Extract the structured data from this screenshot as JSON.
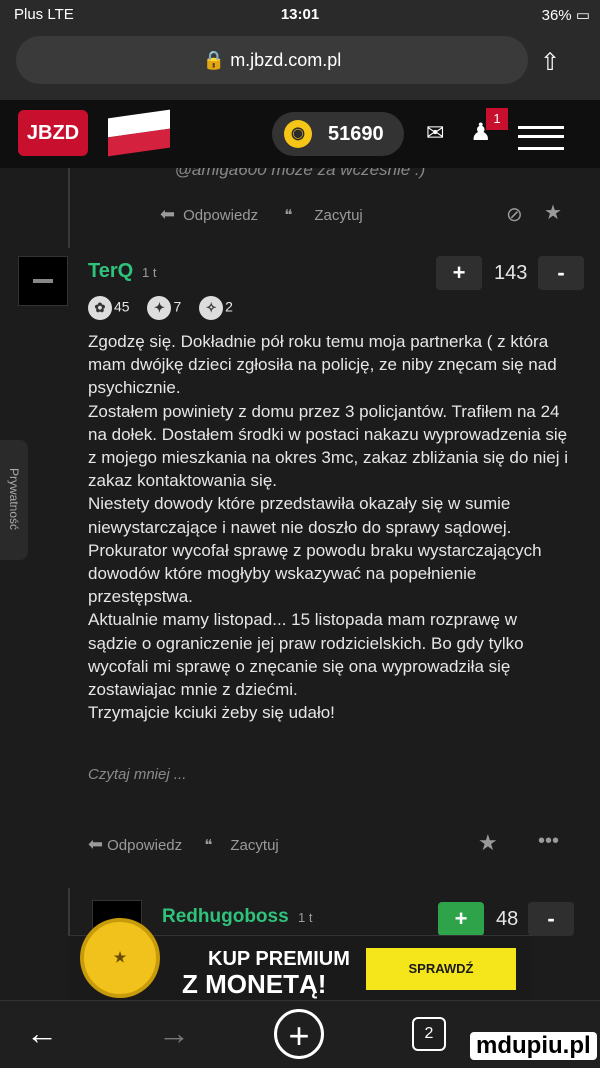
{
  "status": {
    "carrier": "Plus  LTE",
    "time": "13:01",
    "battery": "36%"
  },
  "browser": {
    "url": "m.jbzd.com.pl"
  },
  "header": {
    "logo": "JBZD",
    "coins": "51690",
    "notification_count": "1"
  },
  "prev_comment": {
    "faded_text": "@amiga600 może za wcześnie :)",
    "reply_label": "Odpowiedz",
    "quote_label": "Zacytuj"
  },
  "comment": {
    "author": "TerQ",
    "age": "1 t",
    "score": "143",
    "badges": [
      "45",
      "7",
      "2"
    ],
    "body": "Zgodzę się. Dokładnie pół roku temu moja partnerka ( z która mam dwójkę dzieci zgłosiła na policję, ze niby znęcam się nad psychicznie.\nZostałem powiniety z domu przez 3 policjantów. Trafiłem na 24 na dołek. Dostałem środki w postaci nakazu wyprowadzenia się z mojego mieszkania na okres 3mc, zakaz zbliżania się do niej i zakaz kontaktowania się.\nNiestety dowody które przedstawiła okazały się w sumie niewystarczające i nawet nie doszło do sprawy sądowej. Prokurator wycofał sprawę z powodu braku wystarczających dowodów które mogłyby wskazywać na popełnienie przestępstwa.\nAktualnie mamy listopad... 15 listopada mam rozprawę w sądzie o ograniczenie jej praw rodzicielskich. Bo gdy tylko wycofali mi sprawę o znęcanie się ona wyprowadziła się zostawiajac mnie z dziećmi.\nTrzymajcie kciuki żeby się udało!",
    "read_more": "Czytaj mniej ...",
    "reply_label": "Odpowiedz",
    "quote_label": "Zacytuj"
  },
  "next_comment": {
    "author": "Redhugoboss",
    "age": "1 t",
    "score": "48"
  },
  "privacy_tab": "Prywatność",
  "banner": {
    "line1": "KUP PREMIUM",
    "line2": "Z MONETĄ!",
    "button": "SPRAWDŹ"
  },
  "bottombar": {
    "tabs_count": "2"
  },
  "watermark": "mdupiu.pl"
}
